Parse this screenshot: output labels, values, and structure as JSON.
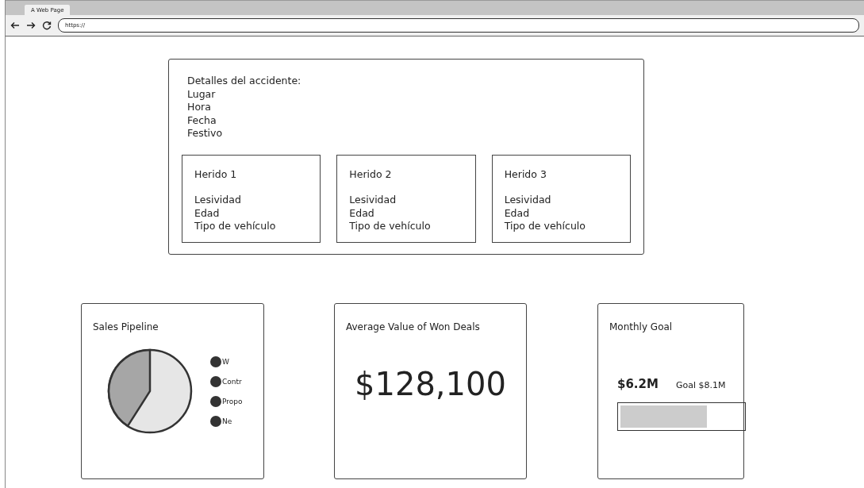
{
  "browser": {
    "tab_title": "A Web Page",
    "url": "https://"
  },
  "accident": {
    "heading": "Detalles del accidente:",
    "fields": [
      "Lugar",
      "Hora",
      "Fecha",
      "Festivo"
    ],
    "injured": [
      {
        "title": "Herido 1",
        "fields": [
          "Lesividad",
          "Edad",
          "Tipo de vehículo"
        ]
      },
      {
        "title": "Herido 2",
        "fields": [
          "Lesividad",
          "Edad",
          "Tipo de vehículo"
        ]
      },
      {
        "title": "Herido 3",
        "fields": [
          "Lesividad",
          "Edad",
          "Tipo de vehículo"
        ]
      }
    ]
  },
  "sales_pipeline": {
    "title": "Sales Pipeline",
    "legend": [
      "W",
      "Contr",
      "Propo",
      "Ne"
    ]
  },
  "average_won": {
    "title": "Average Value of Won Deals",
    "value": "$128,100"
  },
  "monthly_goal": {
    "title": "Monthly Goal",
    "value": "$6.2M",
    "goal": "Goal $8.1M",
    "level": 0.71
  }
}
